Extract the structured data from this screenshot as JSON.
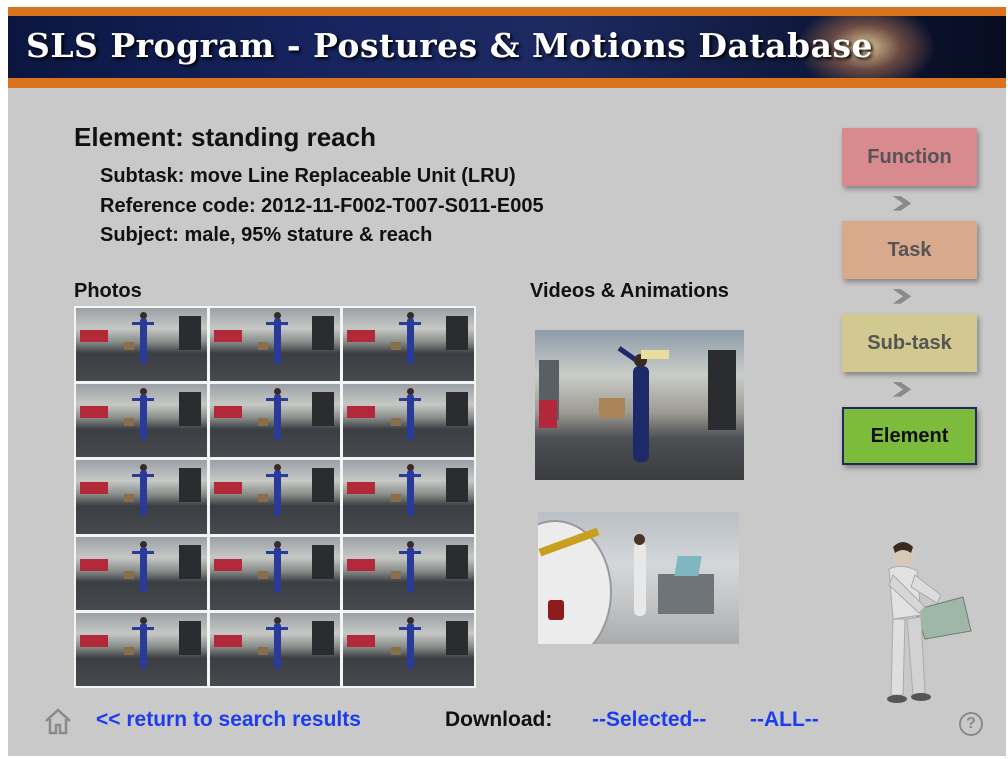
{
  "header": {
    "title": "SLS Program - Postures & Motions Database"
  },
  "element": {
    "title": "Element:  standing reach",
    "subtask": "Subtask:  move Line Replaceable Unit (LRU)",
    "reference": "Reference code:  2012-11-F002-T007-S011-E005",
    "subject": "Subject:  male, 95% stature & reach"
  },
  "sections": {
    "photos": "Photos",
    "videos": "Videos & Animations"
  },
  "nav": {
    "function": "Function",
    "task": "Task",
    "subtask": "Sub-task",
    "element": "Element"
  },
  "footer": {
    "return_link": "<< return to search results",
    "download_label": "Download:",
    "selected": "--Selected--",
    "all": "--ALL--",
    "help": "?"
  },
  "colors": {
    "accent_orange": "#d9731e",
    "link_blue": "#1d3cf0",
    "function_box": "#d98a8e",
    "task_box": "#d9a98c",
    "subtask_box": "#d2c990",
    "element_box": "#7dbb3c"
  }
}
